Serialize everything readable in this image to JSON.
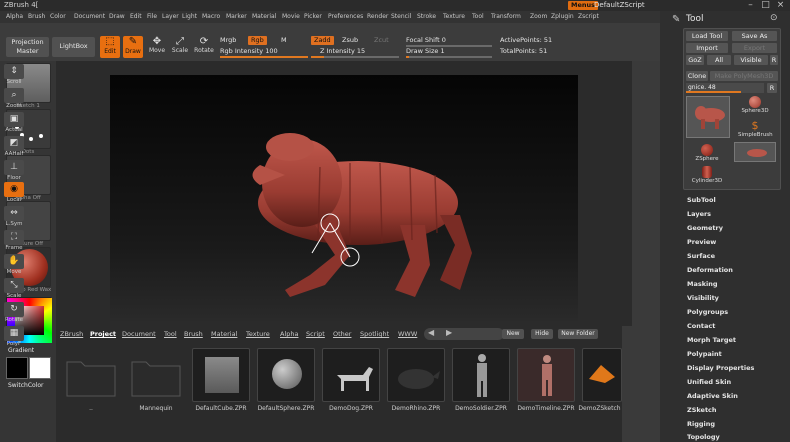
{
  "window": {
    "title": "ZBrush 4[",
    "menus_label": "Menus",
    "zscript_name": "DefaultZScript"
  },
  "menubar": [
    "Alpha",
    "Brush",
    "Color",
    "Document",
    "Draw",
    "Edit",
    "File",
    "Layer",
    "Light",
    "Macro",
    "Marker",
    "Material",
    "Movie",
    "Picker",
    "Preferences",
    "Render",
    "Stencil",
    "Stroke",
    "Texture",
    "Tool",
    "Transform",
    "Zoom",
    "Zplugin",
    "Zscript"
  ],
  "toolbar": {
    "projection_master": "Projection Master",
    "lightbox": "LightBox",
    "edit": "Edit",
    "draw": "Draw",
    "move": "Move",
    "scale": "Scale",
    "rotate": "Rotate",
    "mrgb": "Mrgb",
    "rgb": "Rgb",
    "m": "M",
    "rgb_intensity_label": "Rgb Intensity",
    "rgb_intensity": "100",
    "rgb_intensity_pct": 1.0,
    "zadd": "Zadd",
    "zsub": "Zsub",
    "zcut": "Zcut",
    "z_intensity_label": "Z Intensity",
    "z_intensity": "15",
    "z_intensity_pct": 0.15,
    "focal_shift_label": "Focal Shift",
    "focal_shift": "0",
    "draw_size_label": "Draw Size",
    "draw_size": "1",
    "active_points_label": "ActivePoints:",
    "active_points": "51",
    "total_points_label": "TotalPoints:",
    "total_points": "51"
  },
  "left_shelf": [
    {
      "name": "Sketch 1"
    },
    {
      "name": "Dots"
    },
    {
      "name": "Alpha Off"
    },
    {
      "name": "Texture Off"
    },
    {
      "name": "MatCap Red Wax"
    }
  ],
  "left_labels": {
    "gradient": "Gradient",
    "switch_color": "SwitchColor"
  },
  "right_shelf": [
    "Scroll",
    "Zoom",
    "Actual",
    "AAHalf",
    "Floor",
    "Local",
    "L.Sym",
    "Frame",
    "Move",
    "Scale",
    "Rotate",
    "PolyF"
  ],
  "lightbox": {
    "tabs": [
      "ZBrush",
      "Project",
      "Document",
      "Tool",
      "Brush",
      "Material",
      "Texture",
      "Alpha",
      "Script",
      "Other",
      "Spotlight",
      "WWW"
    ],
    "buttons": [
      "New",
      "Hide",
      "New Folder"
    ],
    "items": [
      "..",
      "Mannequin",
      "DefaultCube.ZPR",
      "DefaultSphere.ZPR",
      "DemoDog.ZPR",
      "DemoRhino.ZPR",
      "DemoSoldier.ZPR",
      "DemoTimeline.ZPR",
      "DemoZSketch"
    ]
  },
  "tool_panel": {
    "title": "Tool",
    "load_tool": "Load Tool",
    "save_as": "Save As",
    "import": "Import",
    "export": "Export",
    "goz": "GoZ",
    "all": "All",
    "visible": "Visible",
    "r": "R",
    "clone": "Clone",
    "make_polymesh": "Make PolyMesh3D",
    "goz_value_label": "gnice.",
    "goz_value": "48",
    "tools": [
      "Sphere3D",
      "SimpleBrush",
      "ZSphere",
      "Cylinder3D"
    ],
    "menus": [
      "SubTool",
      "Layers",
      "Geometry",
      "Preview",
      "Surface",
      "Deformation",
      "Masking",
      "Visibility",
      "Polygroups",
      "Contact",
      "Morph Target",
      "Polypaint",
      "Display Properties",
      "Unified Skin",
      "Adaptive Skin",
      "ZSketch",
      "Rigging",
      "Topology"
    ]
  },
  "colors": {
    "accent": "#e8701a",
    "model": "#a4443a"
  }
}
